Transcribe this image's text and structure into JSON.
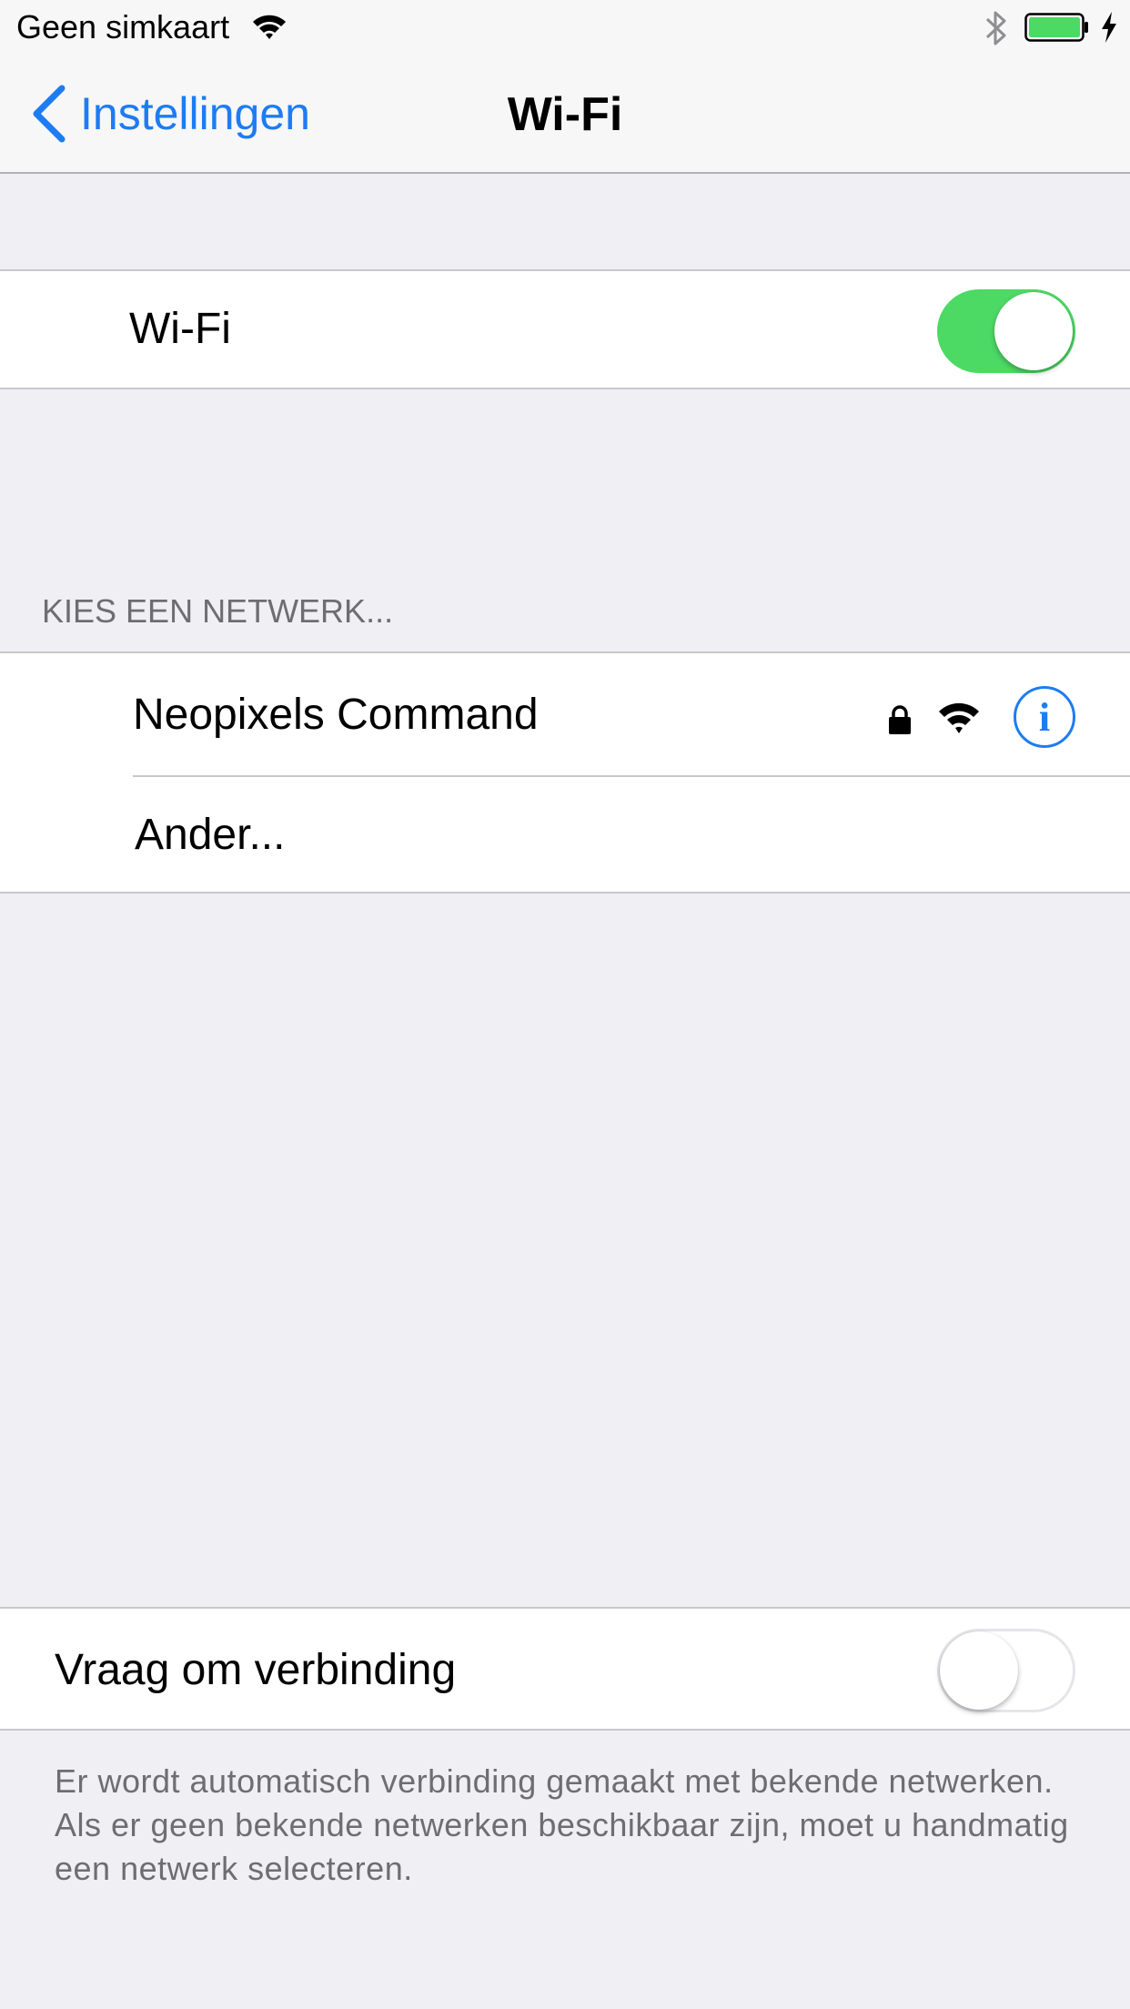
{
  "status_bar": {
    "carrier": "Geen simkaart",
    "wifi_icon": "wifi-icon",
    "bluetooth_icon": "bluetooth-icon",
    "battery_icon": "battery-icon",
    "charging_icon": "charging-bolt-icon",
    "battery_color": "#4cd964"
  },
  "nav": {
    "back_label": "Instellingen",
    "title": "Wi-Fi"
  },
  "wifi_row": {
    "label": "Wi-Fi",
    "toggle_on": true
  },
  "networks": {
    "header": "KIES EEN NETWERK...",
    "items": [
      {
        "name": "Neopixels Command",
        "secured": true,
        "signal": "full"
      }
    ],
    "other_label": "Ander..."
  },
  "ask_row": {
    "label": "Vraag om verbinding",
    "toggle_on": false
  },
  "footer": {
    "text": "Er wordt automatisch verbinding gemaakt met bekende netwerken. Als er geen bekende netwerken beschikbaar zijn, moet u handmatig een netwerk selecteren."
  },
  "colors": {
    "accent": "#1e7cf2",
    "toggle_on": "#4cd964",
    "background": "#efeff4",
    "secondary_text": "#6d6d72"
  }
}
